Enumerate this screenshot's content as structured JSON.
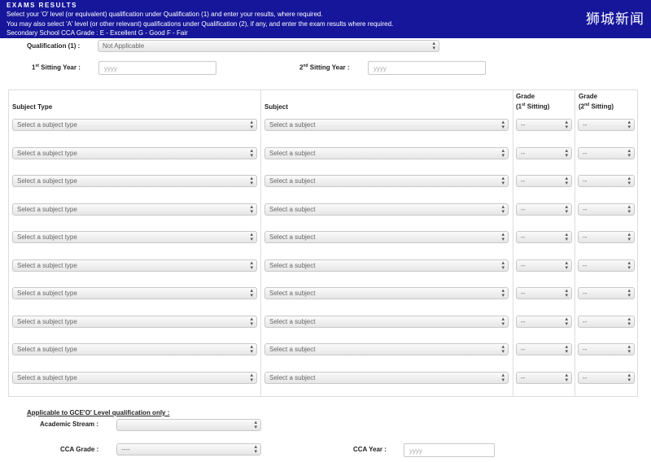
{
  "header": {
    "title": "EXAMS RESULTS",
    "lines": [
      "Select your 'O' level (or equivalent) qualification under Qualification (1) and enter your results, where required.",
      "You may also select 'A' level (or other relevant) qualifications under Qualification (2), if any, and enter the exam results where required.",
      "Secondary School CCA Grade : E - Excellent G - Good F - Fair"
    ],
    "watermark": "狮城新闻"
  },
  "qualification": {
    "label": "Qualification (1) :",
    "value": "Not Applicable"
  },
  "sitting": {
    "first_prefix": "1",
    "first_sup": "st",
    "first_suffix": " Sitting Year :",
    "first_placeholder": "yyyy",
    "second_prefix": "2",
    "second_sup": "nd",
    "second_suffix": " Sitting Year :",
    "second_placeholder": "yyyy"
  },
  "table": {
    "col_subject_type": "Subject Type",
    "col_subject": "Subject",
    "col_grade1_top": "Grade",
    "col_grade1_bottom_prefix": "(1",
    "col_grade1_sup": "st",
    "col_grade1_bottom_suffix": " Sitting)",
    "col_grade2_top": "Grade",
    "col_grade2_bottom_prefix": "(2",
    "col_grade2_sup": "nd",
    "col_grade2_bottom_suffix": " Sitting)",
    "rows": [
      {
        "subject_type": "Select a subject type",
        "subject": "Select a subject",
        "grade1": "--",
        "grade2": "--"
      },
      {
        "subject_type": "Select a subject type",
        "subject": "Select a subject",
        "grade1": "--",
        "grade2": "--"
      },
      {
        "subject_type": "Select a subject type",
        "subject": "Select a subject",
        "grade1": "--",
        "grade2": "--"
      },
      {
        "subject_type": "Select a subject type",
        "subject": "Select a subject",
        "grade1": "--",
        "grade2": "--"
      },
      {
        "subject_type": "Select a subject type",
        "subject": "Select a subject",
        "grade1": "--",
        "grade2": "--"
      },
      {
        "subject_type": "Select a subject type",
        "subject": "Select a subject",
        "grade1": "--",
        "grade2": "--"
      },
      {
        "subject_type": "Select a subject type",
        "subject": "Select a subject",
        "grade1": "--",
        "grade2": "--"
      },
      {
        "subject_type": "Select a subject type",
        "subject": "Select a subject",
        "grade1": "--",
        "grade2": "--"
      },
      {
        "subject_type": "Select a subject type",
        "subject": "Select a subject",
        "grade1": "--",
        "grade2": "--"
      },
      {
        "subject_type": "Select a subject type",
        "subject": "Select a subject",
        "grade1": "--",
        "grade2": "--"
      }
    ]
  },
  "gce_o": {
    "heading": "Applicable to GCE'O' Level qualification only :",
    "academic_stream_label": "Academic Stream :",
    "academic_stream_value": "",
    "cca_grade_label": "CCA Grade :",
    "cca_grade_value": "----",
    "cca_year_label": "CCA Year :",
    "cca_year_placeholder": "yyyy"
  },
  "icons": {
    "select_arrow": "updown-arrow-icon",
    "arrow_glyph": "▴▾"
  }
}
